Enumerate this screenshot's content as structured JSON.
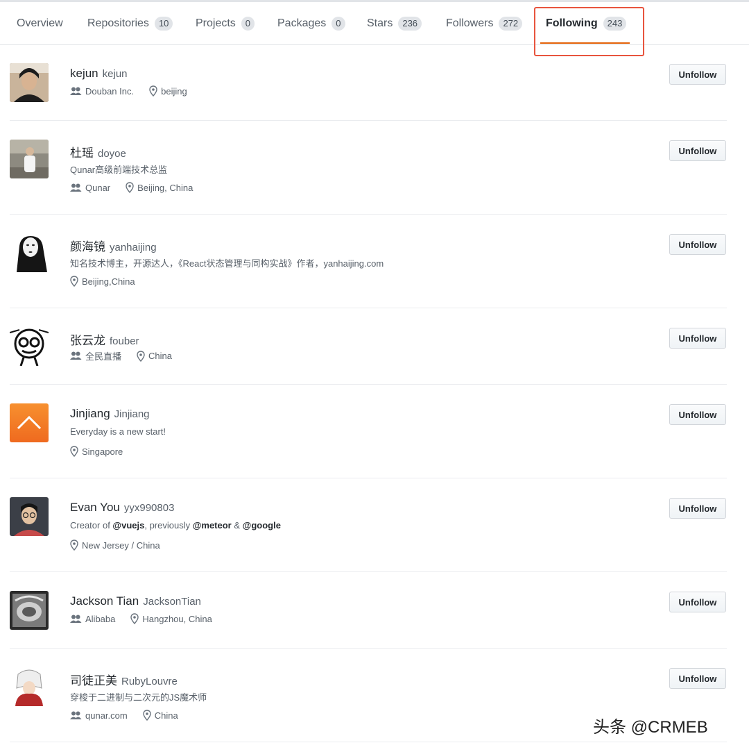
{
  "tabs": [
    {
      "label": "Overview",
      "count": ""
    },
    {
      "label": "Repositories",
      "count": "10"
    },
    {
      "label": "Projects",
      "count": "0"
    },
    {
      "label": "Packages",
      "count": "0"
    },
    {
      "label": "Stars",
      "count": "236"
    },
    {
      "label": "Followers",
      "count": "272"
    },
    {
      "label": "Following",
      "count": "243"
    }
  ],
  "users": [
    {
      "name": "kejun",
      "login": "kejun",
      "bio": "",
      "company": "Douban Inc.",
      "location": "beijing",
      "button": "Unfollow"
    },
    {
      "name": "杜瑶",
      "login": "doyoe",
      "bio": "Qunar高级前端技术总监",
      "company": "Qunar",
      "location": "Beijing, China",
      "button": "Unfollow"
    },
    {
      "name": "颜海镜",
      "login": "yanhaijing",
      "bio": "知名技术博主，开源达人，《React状态管理与同构实战》作者，yanhaijing.com",
      "company": "",
      "location": "Beijing,China",
      "button": "Unfollow"
    },
    {
      "name": "张云龙",
      "login": "fouber",
      "bio": "",
      "company": "全民直播",
      "location": "China",
      "button": "Unfollow"
    },
    {
      "name": "Jinjiang",
      "login": "Jinjiang",
      "bio": "Everyday is a new start!",
      "company": "",
      "location": "Singapore",
      "button": "Unfollow"
    },
    {
      "name": "Evan You",
      "login": "yyx990803",
      "bio_parts": [
        "Creator of ",
        "@vuejs",
        ", previously ",
        "@meteor",
        " & ",
        "@google"
      ],
      "company": "",
      "location": "New Jersey / China",
      "button": "Unfollow"
    },
    {
      "name": "Jackson Tian",
      "login": "JacksonTian",
      "bio": "",
      "company": "Alibaba",
      "location": "Hangzhou, China",
      "button": "Unfollow"
    },
    {
      "name": "司徒正美",
      "login": "RubyLouvre",
      "bio": "穿梭于二进制与二次元的JS魔术师",
      "company": "qunar.com",
      "location": "China",
      "button": "Unfollow"
    }
  ],
  "watermark": "头条 @CRMEB",
  "colors": {
    "accent": "#e36209",
    "highlight": "#e8543e"
  },
  "icons": {
    "company": "people-icon",
    "location": "location-pin-icon"
  }
}
